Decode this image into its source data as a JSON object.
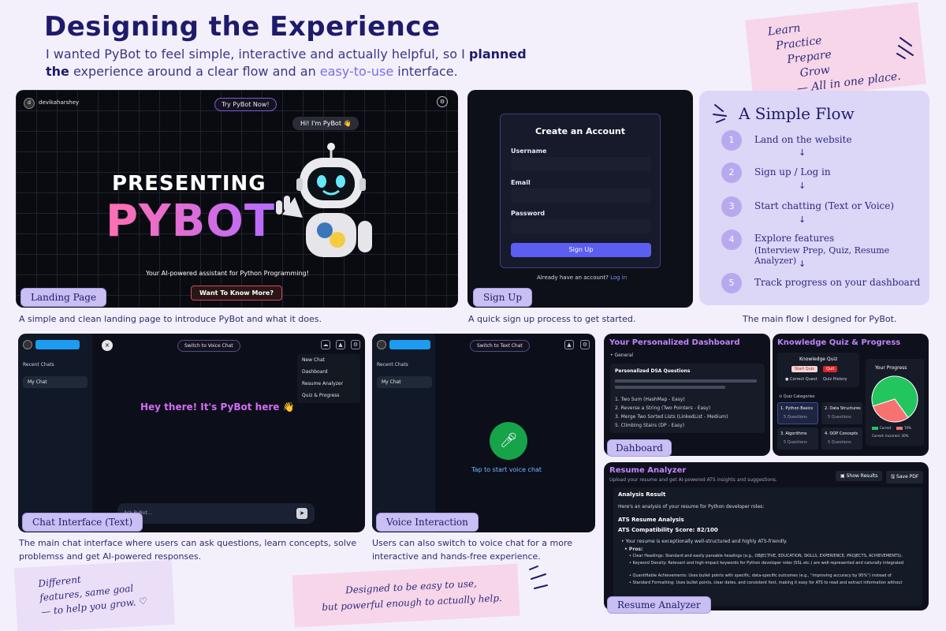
{
  "header": {
    "title": "Designing the Experience",
    "subtitle_parts": [
      "I wanted PyBot to feel simple, interactive and actually helpful, so I ",
      "planned the",
      " experience around a clear flow and an ",
      "easy-to-use",
      " interface."
    ]
  },
  "tagline": [
    "Learn",
    "Practice",
    "Prepare",
    "Grow",
    "— All in one place."
  ],
  "landing": {
    "user": "devikaharshey",
    "try_btn": "Try PyBot Now!",
    "greeting": "Hi! I'm PyBot 👋",
    "presenting": "PRESENTING",
    "pybot": "PYBOT",
    "tagline": "Your AI-powered assistant for Python Programming!",
    "cta": "Want To Know More?",
    "badge": "Landing Page",
    "caption": "A simple and clean landing page to introduce PyBot and what it does."
  },
  "signup": {
    "title": "Create an Account",
    "username": "Username",
    "email": "Email",
    "password": "Password",
    "btn": "Sign Up",
    "have_account": "Already have an account?",
    "login": "Log in",
    "badge": "Sign Up",
    "caption": "A quick sign up process to get started."
  },
  "flow": {
    "title": "A Simple Flow",
    "steps": [
      {
        "n": "1",
        "text": "Land on the website"
      },
      {
        "n": "2",
        "text": "Sign up / Log in"
      },
      {
        "n": "3",
        "text": "Start chatting (Text or Voice)"
      },
      {
        "n": "4",
        "text": "Explore features",
        "sub": "(Interview Prep, Quiz, Resume Analyzer)"
      },
      {
        "n": "5",
        "text": "Track progress on your dashboard"
      }
    ],
    "arrow": "↓",
    "caption": "The main flow I designed for PyBot."
  },
  "chat": {
    "switch_voice": "Switch to Voice Chat",
    "recent": "Recent Chats",
    "my_chat": "My Chat",
    "menu": [
      "New Chat",
      "Dashboard",
      "Resume Analyzer",
      "Quiz & Progress"
    ],
    "hello": "Hey there! It's PyBot here 👋",
    "ask": "Ask PyBot...",
    "badge": "Chat Interface (Text)",
    "caption": "The main chat interface where users can ask questions, learn concepts, solve problemss and get AI-powered responses."
  },
  "voice": {
    "switch_text": "Switch to Text Chat",
    "recent": "Recent Chats",
    "my_chat": "My Chat",
    "tap": "Tap to start voice chat",
    "badge": "Voice Interaction",
    "caption": "Users can also switch to voice chat for a more interactive and hands-free experience."
  },
  "dashboard": {
    "title": "Your Personalized Dashboard",
    "general": "General",
    "dsa": "Personalized DSA Questions",
    "items": [
      "1. Two Sum (HashMap - Easy)",
      "2. Reverse a String (Two Pointers - Easy)",
      "3. Merge Two Sorted Lists (LinkedList - Medium)",
      "5. Climbing Stairs (DP - Easy)"
    ],
    "badge": "Dahboard"
  },
  "quiz": {
    "title": "Knowledge Quiz & Progress",
    "kq": "Knowledge Quiz",
    "start": "Start Quiz",
    "quit": "Quit",
    "correct_ans": "Correct Quest",
    "history": "Quiz History",
    "categories": "Quiz Categories",
    "cats": [
      {
        "name": "1. Python Basics",
        "q": "5 Questions"
      },
      {
        "name": "2. Data Structures",
        "q": "5 Questions"
      },
      {
        "name": "3. Algorithms",
        "q": "5 Questions"
      },
      {
        "name": "4. OOP Concepts",
        "q": "5 Questions"
      }
    ],
    "progress": "Your Progress",
    "correct": "Correct",
    "incorrect_pct": "70%",
    "summary": "Correct: Incorrect: 30%"
  },
  "chart_data": {
    "type": "pie",
    "title": "Your Progress",
    "categories": [
      "Correct",
      "Incorrect"
    ],
    "values": [
      70,
      30
    ],
    "colors": [
      "#22c55e",
      "#f87171"
    ]
  },
  "resume": {
    "title": "Resume Analyzer",
    "subtitle": "Upload your resume and get AI-powered ATS insights and suggestions.",
    "show": "Show Results",
    "save": "Save PDF",
    "result": "Analysis Result",
    "intro": "Here's an analysis of your resume for Python developer roles:",
    "ats": "ATS Resume Analysis",
    "score": "ATS Compatibility Score: 82/100",
    "bullet": "• Your resume is exceptionally well-structured and highly ATS-friendly.",
    "pros": "• Pros:",
    "p1": "• Clear Headings: Standard and easily parsable headings (e.g., OBJECTIVE, EDUCATION, SKILLS, EXPERIENCE, PROJECTS, ACHIEVEMENTS).",
    "p2": "• Keyword Density: Relevant and high-impact keywords for Python developer roles (SSL etc.) are well-represented and naturally integrated",
    "p3": "• Quantifiable Achievements: Uses bullet points with specific, data-specific outcomes (e.g., \"improving accuracy by 95%\") instead of",
    "p4": "• Standard Formatting: Uses bullet points, clear dates, and consistent font, making it easy for ATS to read and extract information without",
    "badge": "Resume Analyzer"
  },
  "bottom": {
    "left_note": [
      "Different",
      "features, same goal",
      "— to help you grow. ♡"
    ],
    "center_note": [
      "Designed to be easy to use,",
      "but powerful enough to actually help."
    ]
  },
  "colors": {
    "accent": "#7c5cd6",
    "navy": "#1e1b6b",
    "badge": "#c9bff3"
  }
}
